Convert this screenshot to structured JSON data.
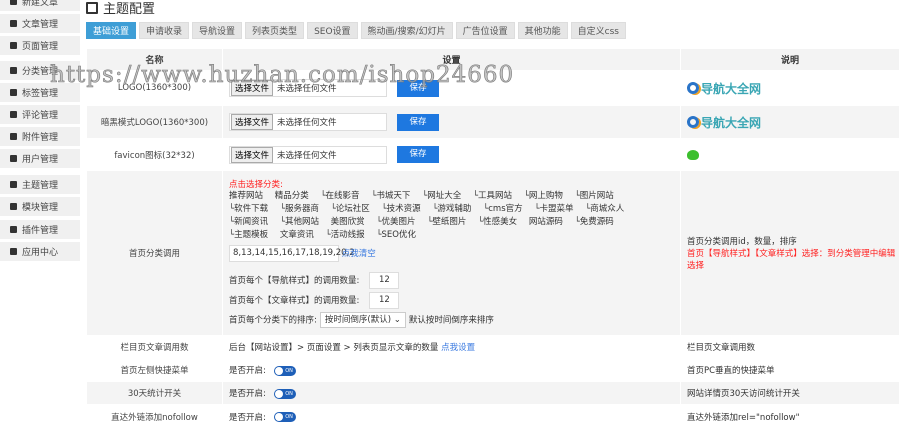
{
  "sidebar": {
    "items": [
      "新建文章",
      "文章管理",
      "页面管理",
      "分类管理",
      "标签管理",
      "评论管理",
      "附件管理",
      "用户管理",
      "主题管理",
      "模块管理",
      "插件管理",
      "应用中心"
    ]
  },
  "header": {
    "title": "主题配置"
  },
  "tabs": [
    "基础设置",
    "申请收录",
    "导航设置",
    "列表页类型",
    "SEO设置",
    "熊动画/搜索/幻灯片",
    "广告位设置",
    "其他功能",
    "自定义css"
  ],
  "table": {
    "headers": [
      "名称",
      "设置",
      "说明"
    ],
    "file_button": "选择文件",
    "file_none": "未选择任何文件",
    "save": "保存",
    "logo_text": "导航大全网",
    "rows": {
      "logo": "LOGO(1360*300)",
      "dark_logo": "暗黑模式LOGO(1360*300)",
      "favicon": "favicon图标(32*32)",
      "category": "首页分类调用",
      "column": "栏目页文章调用数",
      "quickmenu": "首页左侧快捷菜单",
      "stats": "30天统计开关",
      "nofollow": "直达外链添加nofollow"
    },
    "category": {
      "pick": "点击选择分类:",
      "list": [
        "推荐网站",
        "精品分类",
        "└在线影音",
        "└书城天下",
        "└网址大全",
        "└工具网站",
        "└网上购物",
        "└图片网站",
        "└软件下载",
        "└服务器商",
        "└论坛社区",
        "└技术资源",
        "└游戏辅助",
        "└cms官方",
        "└卡盟菜单",
        "└商城众人",
        "└新闻资讯",
        "└其他网站",
        "美图欣赏",
        "└优美图片",
        "└壁纸图片",
        "└性感美女",
        "网站源码",
        "└免费源码",
        "└主题模板",
        "文章资讯",
        "└活动线报",
        "└SEO优化"
      ],
      "ids": "8,13,14,15,16,17,18,19,20,2",
      "clear": "点我清空",
      "nav_count_label": "首页每个【导航样式】的调用数量:",
      "nav_count": "12",
      "art_count_label": "首页每个【文章样式】的调用数量:",
      "art_count": "12",
      "order_label": "首页每个分类下的排序:",
      "order_value": "按时间倒序(默认)",
      "order_hint": "默认按时间倒序来排序",
      "desc1": "首页分类调用id，数量，排序",
      "desc2": "首页【导航样式】【文章样式】选择：到分类管理中编辑选择"
    },
    "column_setting": "后台【网站设置】> 页面设置 > 列表页显示文章的数量",
    "column_link": "点我设置",
    "column_desc": "栏目页文章调用数",
    "on_label": "是否开启:",
    "toggle_text": "ON",
    "quickmenu_desc": "首页PC垂直的快捷菜单",
    "stats_desc": "网站详情页30天访问统计开关",
    "nofollow_desc": "直达外链添加rel=\"nofollow\""
  },
  "watermark": "https://www.huzhan.com/ishop24660"
}
